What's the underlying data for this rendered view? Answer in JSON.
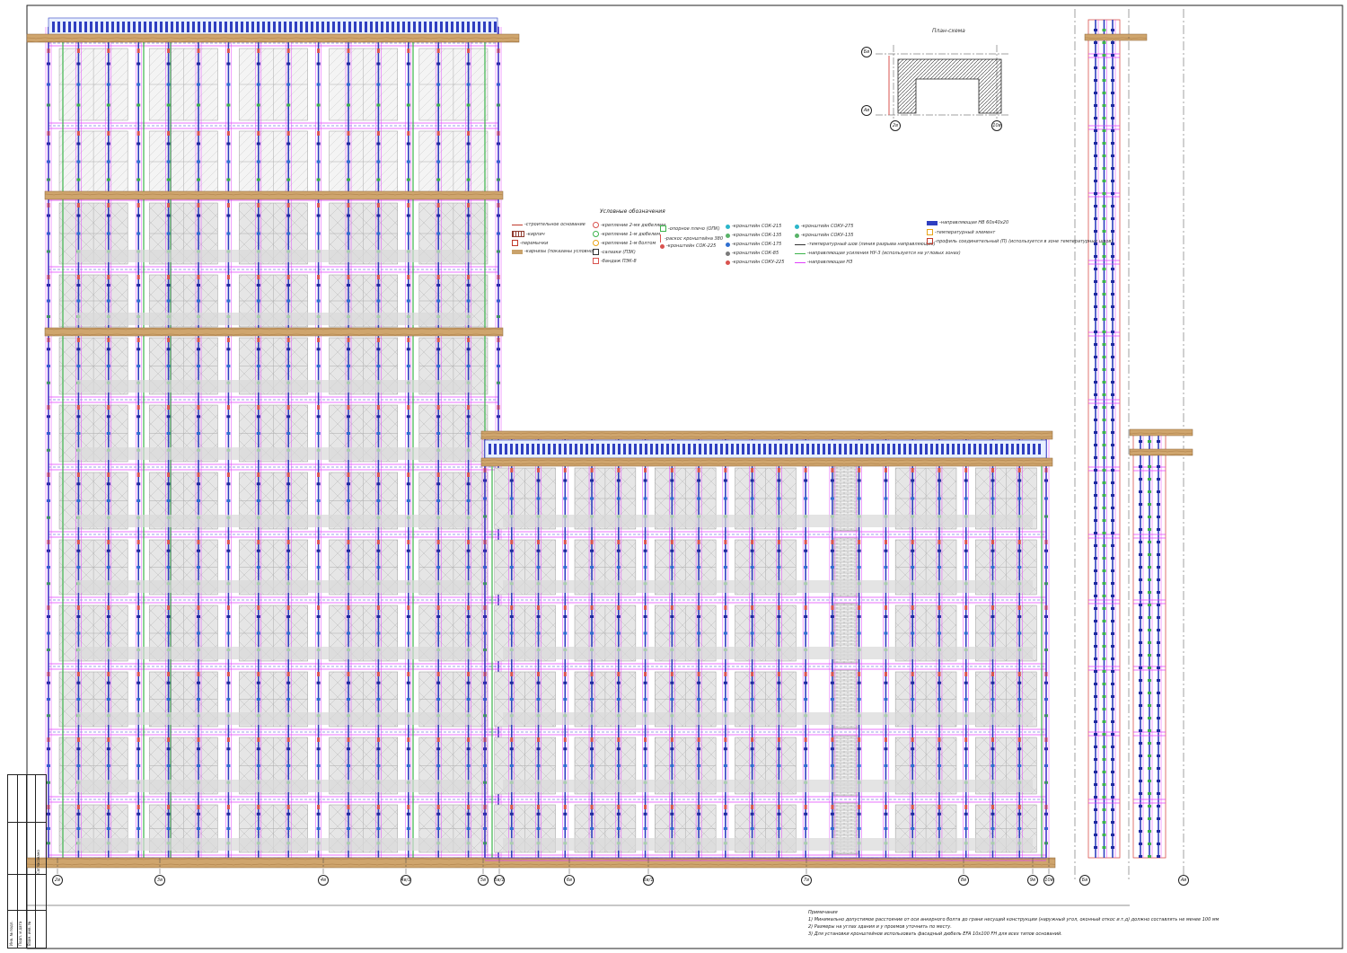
{
  "drawing": {
    "plan_title": "План-схема",
    "legend_title": "Условные обозначения",
    "legend": [
      {
        "label": "-строительное основание",
        "color": "#c0392b",
        "kind": "line"
      },
      {
        "label": "-кирпич",
        "color": "#8e3b2f",
        "kind": "hatch"
      },
      {
        "label": "-перемычки",
        "color": "#c0392b",
        "kind": "box"
      },
      {
        "label": "-карнизы (показаны условно)",
        "color": "#c9a26b",
        "kind": "fill"
      },
      {
        "label": "-крепление 2-мя дюбелями",
        "color": "#d9534f",
        "kind": "circle"
      },
      {
        "label": "-крепление 1-м дюбелем",
        "color": "#3cb44b",
        "kind": "circle"
      },
      {
        "label": "-крепление 1-м болтом",
        "color": "#e8a317",
        "kind": "circle"
      },
      {
        "label": "-салазки (ПЗК)",
        "color": "#333333",
        "kind": "box"
      },
      {
        "label": "-бандаж ПЭК-8",
        "color": "#d9534f",
        "kind": "box"
      },
      {
        "label": "-опорное плечо (ОПК)",
        "color": "#3cb44b",
        "kind": "box"
      },
      {
        "label": "-раскос кронштейна 380",
        "color": "#d9534f",
        "kind": "vline"
      },
      {
        "label": "-кронштейн СОК-225",
        "color": "#d9534f",
        "kind": "dot"
      },
      {
        "label": "-кронштейн СОК-215",
        "color": "#2bb6c9",
        "kind": "dot"
      },
      {
        "label": "-кронштейн СОК-135",
        "color": "#58b368",
        "kind": "dot"
      },
      {
        "label": "-кронштейн СОК-175",
        "color": "#2f6fd0",
        "kind": "dot"
      },
      {
        "label": "-кронштейн СОК-85",
        "color": "#7a7a7a",
        "kind": "dot"
      },
      {
        "label": "-кронштейн СОКУ-225",
        "color": "#d9534f",
        "kind": "dot"
      },
      {
        "label": "-кронштейн СОКУ-275",
        "color": "#2bb6c9",
        "kind": "dot"
      },
      {
        "label": "-кронштейн СОКУ-135",
        "color": "#58b368",
        "kind": "dot"
      },
      {
        "label": "-температурный шов (линия разрыва направляющих)",
        "color": "#333333",
        "kind": "line"
      },
      {
        "label": "-направляющая усиления НУ-3 (используется на угловых зонах)",
        "color": "#3cb44b",
        "kind": "line"
      },
      {
        "label": "-направляющая НЗ",
        "color": "#e040fb",
        "kind": "line"
      },
      {
        "label": "-направляющая НВ 60х40х20",
        "color": "#2f3fc0",
        "kind": "fill"
      },
      {
        "label": "-температурный элемент",
        "color": "#e8a317",
        "kind": "box"
      },
      {
        "label": "-профиль соединительный (П) (используется в зоне температурных швов)",
        "color": "#c0392b",
        "kind": "box"
      }
    ],
    "notes": [
      "Примечания",
      "1) Минимально допустимое расстояние от оси анкерного болта до грани несущей конструкции (наружный угол, оконный откос и.т.д) должно составлять не менее 100 мм",
      "2) Размеры на углах здания и у проемов уточнить по месту.",
      "3) Для установки кронштейнов использовать фасадный дюбель EFA 10х100 FH для всех типов оснований."
    ],
    "axes_bottom": [
      "2в",
      "3в",
      "4в",
      "4в/1",
      "5в",
      "5в/1",
      "6в",
      "6в/1",
      "7в",
      "8в",
      "9в",
      "10в"
    ],
    "axes_right": [
      "Бв",
      "Ав"
    ],
    "plan_axes": [
      "2в",
      "5в",
      "10в",
      "Бв",
      "Ав"
    ],
    "stamp": [
      "Инв. № подл.",
      "Подп. и дата",
      "Взам. инв. №",
      "Согласовано"
    ]
  }
}
